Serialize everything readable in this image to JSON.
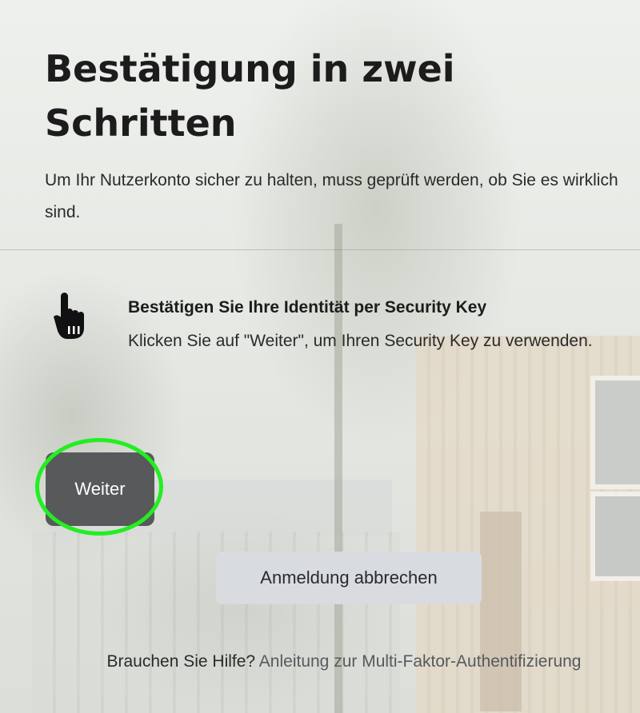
{
  "page": {
    "title": "Bestätigung in zwei Schritten",
    "intro": "Um Ihr Nutzerkonto sicher zu halten, muss geprüft werden, ob Sie es wirklich sind."
  },
  "method": {
    "icon": "hand-pointer-icon",
    "title": "Bestätigen Sie Ihre Identität per Security Key",
    "description": "Klicken Sie auf \"Weiter\", um Ihren Security Key zu verwenden."
  },
  "buttons": {
    "continue_label": "Weiter",
    "cancel_label": "Anmeldung abbrechen"
  },
  "help": {
    "question": "Brauchen Sie Hilfe?",
    "link_text": "Anleitung zur Multi-Faktor-Authentifizierung"
  },
  "colors": {
    "primary_button": "#58595b",
    "secondary_button": "#d8dce0",
    "highlight": "#22ee22"
  }
}
